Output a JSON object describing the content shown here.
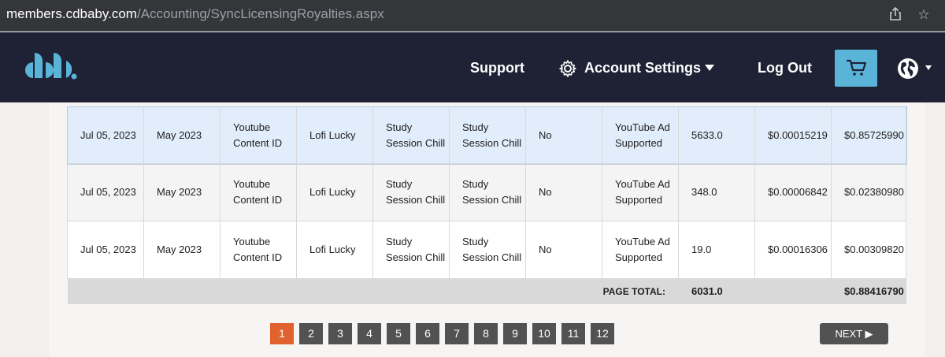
{
  "browser": {
    "url_host": "members.cdbaby.com",
    "url_path": "/Accounting/SyncLicensingRoyalties.aspx"
  },
  "header": {
    "support": "Support",
    "account_settings": "Account Settings",
    "logout": "Log Out"
  },
  "table": {
    "rows": [
      [
        "Jul 05, 2023",
        "May 2023",
        "Youtube Content ID",
        "Lofi Lucky",
        "Study Session Chill",
        "Study Session Chill",
        "No",
        "YouTube Ad Supported",
        "5633.0",
        "$0.00015219",
        "$0.85725990"
      ],
      [
        "Jul 05, 2023",
        "May 2023",
        "Youtube Content ID",
        "Lofi Lucky",
        "Study Session Chill",
        "Study Session Chill",
        "No",
        "YouTube Ad Supported",
        "348.0",
        "$0.00006842",
        "$0.02380980"
      ],
      [
        "Jul 05, 2023",
        "May 2023",
        "Youtube Content ID",
        "Lofi Lucky",
        "Study Session Chill",
        "Study Session Chill",
        "No",
        "YouTube Ad Supported",
        "19.0",
        "$0.00016306",
        "$0.00309820"
      ]
    ],
    "total_label": "PAGE TOTAL:",
    "total_quantity": "6031.0",
    "total_amount": "$0.88416790"
  },
  "pagination": {
    "pages": [
      "1",
      "2",
      "3",
      "4",
      "5",
      "6",
      "7",
      "8",
      "9",
      "10",
      "11",
      "12"
    ],
    "current": "1",
    "next_label": "NEXT ▶"
  },
  "colors": {
    "header_bg": "#1f2135",
    "accent": "#5ab4d8",
    "active_page": "#e0622e"
  }
}
